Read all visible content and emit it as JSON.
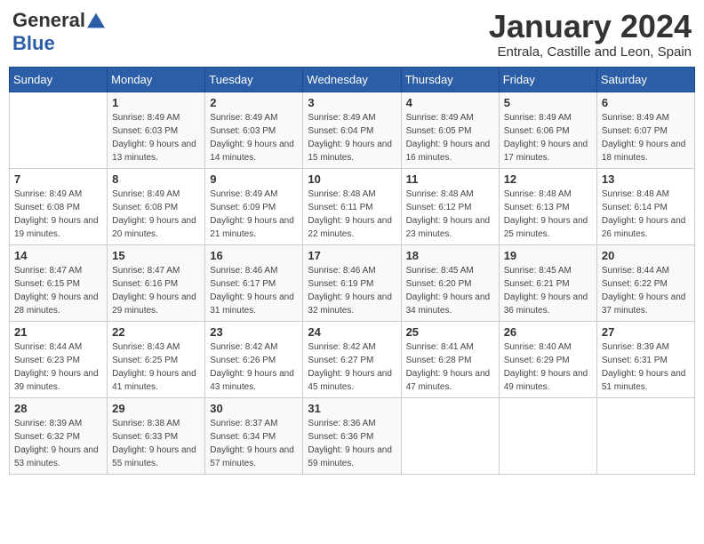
{
  "header": {
    "logo_general": "General",
    "logo_blue": "Blue",
    "title": "January 2024",
    "location": "Entrala, Castille and Leon, Spain"
  },
  "weekdays": [
    "Sunday",
    "Monday",
    "Tuesday",
    "Wednesday",
    "Thursday",
    "Friday",
    "Saturday"
  ],
  "weeks": [
    [
      {
        "day": "",
        "sunrise": "",
        "sunset": "",
        "daylight": ""
      },
      {
        "day": "1",
        "sunrise": "Sunrise: 8:49 AM",
        "sunset": "Sunset: 6:03 PM",
        "daylight": "Daylight: 9 hours and 13 minutes."
      },
      {
        "day": "2",
        "sunrise": "Sunrise: 8:49 AM",
        "sunset": "Sunset: 6:03 PM",
        "daylight": "Daylight: 9 hours and 14 minutes."
      },
      {
        "day": "3",
        "sunrise": "Sunrise: 8:49 AM",
        "sunset": "Sunset: 6:04 PM",
        "daylight": "Daylight: 9 hours and 15 minutes."
      },
      {
        "day": "4",
        "sunrise": "Sunrise: 8:49 AM",
        "sunset": "Sunset: 6:05 PM",
        "daylight": "Daylight: 9 hours and 16 minutes."
      },
      {
        "day": "5",
        "sunrise": "Sunrise: 8:49 AM",
        "sunset": "Sunset: 6:06 PM",
        "daylight": "Daylight: 9 hours and 17 minutes."
      },
      {
        "day": "6",
        "sunrise": "Sunrise: 8:49 AM",
        "sunset": "Sunset: 6:07 PM",
        "daylight": "Daylight: 9 hours and 18 minutes."
      }
    ],
    [
      {
        "day": "7",
        "sunrise": "",
        "sunset": "",
        "daylight": ""
      },
      {
        "day": "8",
        "sunrise": "Sunrise: 8:49 AM",
        "sunset": "Sunset: 6:08 PM",
        "daylight": "Daylight: 9 hours and 20 minutes."
      },
      {
        "day": "9",
        "sunrise": "Sunrise: 8:49 AM",
        "sunset": "Sunset: 6:09 PM",
        "daylight": "Daylight: 9 hours and 21 minutes."
      },
      {
        "day": "10",
        "sunrise": "Sunrise: 8:48 AM",
        "sunset": "Sunset: 6:11 PM",
        "daylight": "Daylight: 9 hours and 22 minutes."
      },
      {
        "day": "11",
        "sunrise": "Sunrise: 8:48 AM",
        "sunset": "Sunset: 6:12 PM",
        "daylight": "Daylight: 9 hours and 23 minutes."
      },
      {
        "day": "12",
        "sunrise": "Sunrise: 8:48 AM",
        "sunset": "Sunset: 6:13 PM",
        "daylight": "Daylight: 9 hours and 25 minutes."
      },
      {
        "day": "13",
        "sunrise": "Sunrise: 8:48 AM",
        "sunset": "Sunset: 6:14 PM",
        "daylight": "Daylight: 9 hours and 26 minutes."
      }
    ],
    [
      {
        "day": "14",
        "sunrise": "",
        "sunset": "",
        "daylight": ""
      },
      {
        "day": "15",
        "sunrise": "Sunrise: 8:47 AM",
        "sunset": "Sunset: 6:16 PM",
        "daylight": "Daylight: 9 hours and 29 minutes."
      },
      {
        "day": "16",
        "sunrise": "Sunrise: 8:46 AM",
        "sunset": "Sunset: 6:17 PM",
        "daylight": "Daylight: 9 hours and 31 minutes."
      },
      {
        "day": "17",
        "sunrise": "Sunrise: 8:46 AM",
        "sunset": "Sunset: 6:19 PM",
        "daylight": "Daylight: 9 hours and 32 minutes."
      },
      {
        "day": "18",
        "sunrise": "Sunrise: 8:45 AM",
        "sunset": "Sunset: 6:20 PM",
        "daylight": "Daylight: 9 hours and 34 minutes."
      },
      {
        "day": "19",
        "sunrise": "Sunrise: 8:45 AM",
        "sunset": "Sunset: 6:21 PM",
        "daylight": "Daylight: 9 hours and 36 minutes."
      },
      {
        "day": "20",
        "sunrise": "Sunrise: 8:44 AM",
        "sunset": "Sunset: 6:22 PM",
        "daylight": "Daylight: 9 hours and 37 minutes."
      }
    ],
    [
      {
        "day": "21",
        "sunrise": "",
        "sunset": "",
        "daylight": ""
      },
      {
        "day": "22",
        "sunrise": "Sunrise: 8:43 AM",
        "sunset": "Sunset: 6:25 PM",
        "daylight": "Daylight: 9 hours and 41 minutes."
      },
      {
        "day": "23",
        "sunrise": "Sunrise: 8:42 AM",
        "sunset": "Sunset: 6:26 PM",
        "daylight": "Daylight: 9 hours and 43 minutes."
      },
      {
        "day": "24",
        "sunrise": "Sunrise: 8:42 AM",
        "sunset": "Sunset: 6:27 PM",
        "daylight": "Daylight: 9 hours and 45 minutes."
      },
      {
        "day": "25",
        "sunrise": "Sunrise: 8:41 AM",
        "sunset": "Sunset: 6:28 PM",
        "daylight": "Daylight: 9 hours and 47 minutes."
      },
      {
        "day": "26",
        "sunrise": "Sunrise: 8:40 AM",
        "sunset": "Sunset: 6:29 PM",
        "daylight": "Daylight: 9 hours and 49 minutes."
      },
      {
        "day": "27",
        "sunrise": "Sunrise: 8:39 AM",
        "sunset": "Sunset: 6:31 PM",
        "daylight": "Daylight: 9 hours and 51 minutes."
      }
    ],
    [
      {
        "day": "28",
        "sunrise": "Sunrise: 8:39 AM",
        "sunset": "Sunset: 6:32 PM",
        "daylight": "Daylight: 9 hours and 53 minutes."
      },
      {
        "day": "29",
        "sunrise": "Sunrise: 8:38 AM",
        "sunset": "Sunset: 6:33 PM",
        "daylight": "Daylight: 9 hours and 55 minutes."
      },
      {
        "day": "30",
        "sunrise": "Sunrise: 8:37 AM",
        "sunset": "Sunset: 6:34 PM",
        "daylight": "Daylight: 9 hours and 57 minutes."
      },
      {
        "day": "31",
        "sunrise": "Sunrise: 8:36 AM",
        "sunset": "Sunset: 6:36 PM",
        "daylight": "Daylight: 9 hours and 59 minutes."
      },
      {
        "day": "",
        "sunrise": "",
        "sunset": "",
        "daylight": ""
      },
      {
        "day": "",
        "sunrise": "",
        "sunset": "",
        "daylight": ""
      },
      {
        "day": "",
        "sunrise": "",
        "sunset": "",
        "daylight": ""
      }
    ]
  ],
  "week1_sun": {
    "sunrise": "Sunrise: 8:49 AM",
    "sunset": "Sunset: 6:08 PM",
    "daylight": "Daylight: 9 hours and 19 minutes."
  },
  "week3_sun": {
    "sunrise": "Sunrise: 8:47 AM",
    "sunset": "Sunset: 6:15 PM",
    "daylight": "Daylight: 9 hours and 28 minutes."
  },
  "week4_sun": {
    "sunrise": "Sunrise: 8:44 AM",
    "sunset": "Sunset: 6:23 PM",
    "daylight": "Daylight: 9 hours and 39 minutes."
  }
}
